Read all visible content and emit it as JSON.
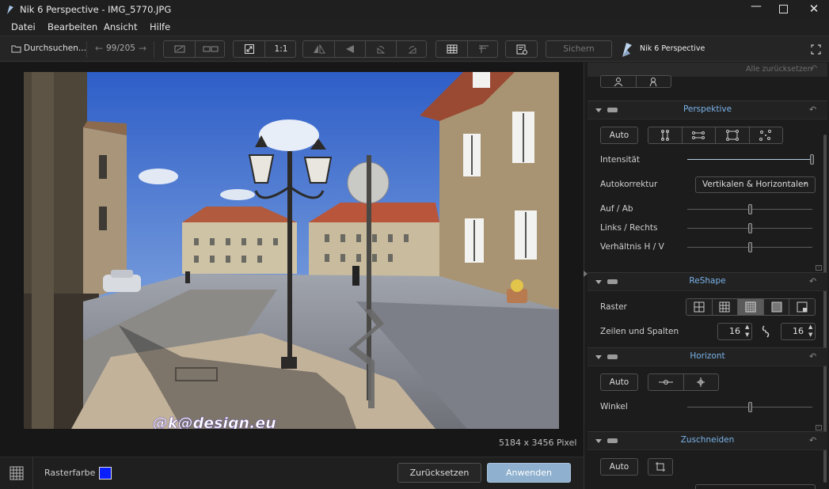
{
  "window": {
    "title": "Nik 6 Perspective - IMG_5770.JPG"
  },
  "menu": {
    "items": [
      "Datei",
      "Bearbeiten",
      "Ansicht",
      "Hilfe"
    ]
  },
  "toolbar": {
    "browse_label": "Durchsuchen...",
    "counter": "99/205",
    "zoom_label": "1:1",
    "save_label": "Sichern",
    "product_name": "Nik 6 Perspective"
  },
  "canvas": {
    "dimensions": "5184 x 3456 Pixel",
    "watermark": "@k@design.eu"
  },
  "bottombar": {
    "grid_color_label": "Rasterfarbe",
    "grid_color": "#0a1fff",
    "reset_label": "Zurücksetzen",
    "apply_label": "Anwenden"
  },
  "panel": {
    "reset_all_label": "Alle zurücksetzen",
    "perspective": {
      "title": "Perspektive",
      "auto_label": "Auto",
      "intensity_label": "Intensität",
      "intensity_value": 100,
      "autocorrect_label": "Autokorrektur",
      "autocorrect_value": "Vertikalen & Horizontalen",
      "updown_label": "Auf / Ab",
      "updown_value": 0,
      "leftright_label": "Links / Rechts",
      "leftright_value": 0,
      "ratio_label": "Verhältnis H / V",
      "ratio_value": 0
    },
    "reshape": {
      "title": "ReShape",
      "grid_label": "Raster",
      "grid_selected_index": 2,
      "rowscols_label": "Zeilen und Spalten",
      "rows": "16",
      "cols": "16"
    },
    "horizon": {
      "title": "Horizont",
      "auto_label": "Auto",
      "angle_label": "Winkel",
      "angle_value": 0
    },
    "crop": {
      "title": "Zuschneiden",
      "auto_label": "Auto"
    }
  },
  "colors": {
    "accent": "#7ab4ea",
    "apply_button": "#8fb1cf"
  }
}
